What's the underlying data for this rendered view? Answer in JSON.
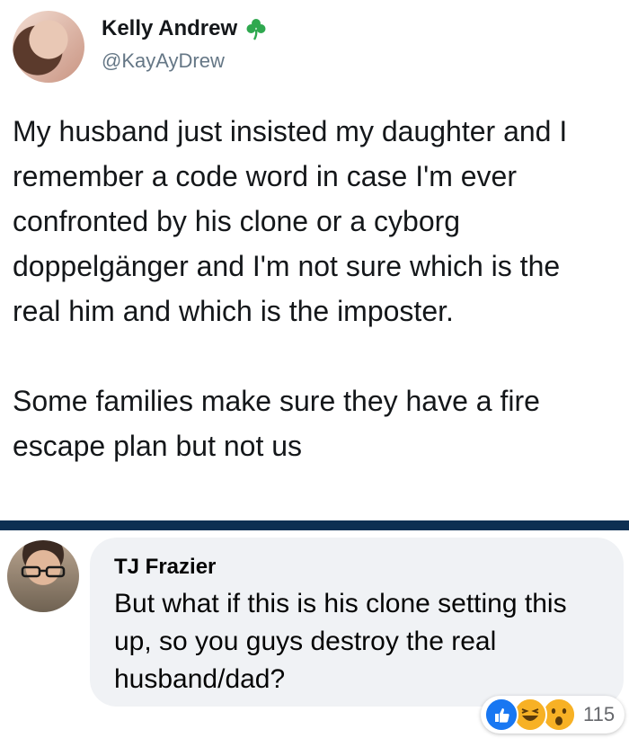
{
  "tweet": {
    "author_name": "Kelly Andrew",
    "author_handle": "@KayAyDrew",
    "badge_icon": "shamrock-icon",
    "paragraph_1": "My husband just insisted my daughter and I remember a code word in case I'm ever confronted by his clone or a cyborg doppelgänger and I'm not sure which is the real him and which is the imposter.",
    "paragraph_2": "Some families make sure they have a fire escape plan but not us"
  },
  "comment": {
    "author_name": "TJ Frazier",
    "text": "But what if this is his clone setting this up, so you guys destroy the real husband/dad?",
    "reactions": {
      "icons": [
        "like-icon",
        "haha-icon",
        "wow-icon"
      ],
      "count": "115"
    }
  },
  "colors": {
    "divider": "#0d2f52",
    "handle": "#657786",
    "bubble": "#f0f2f5",
    "like": "#1877f2",
    "emoji": "#f7b125"
  }
}
